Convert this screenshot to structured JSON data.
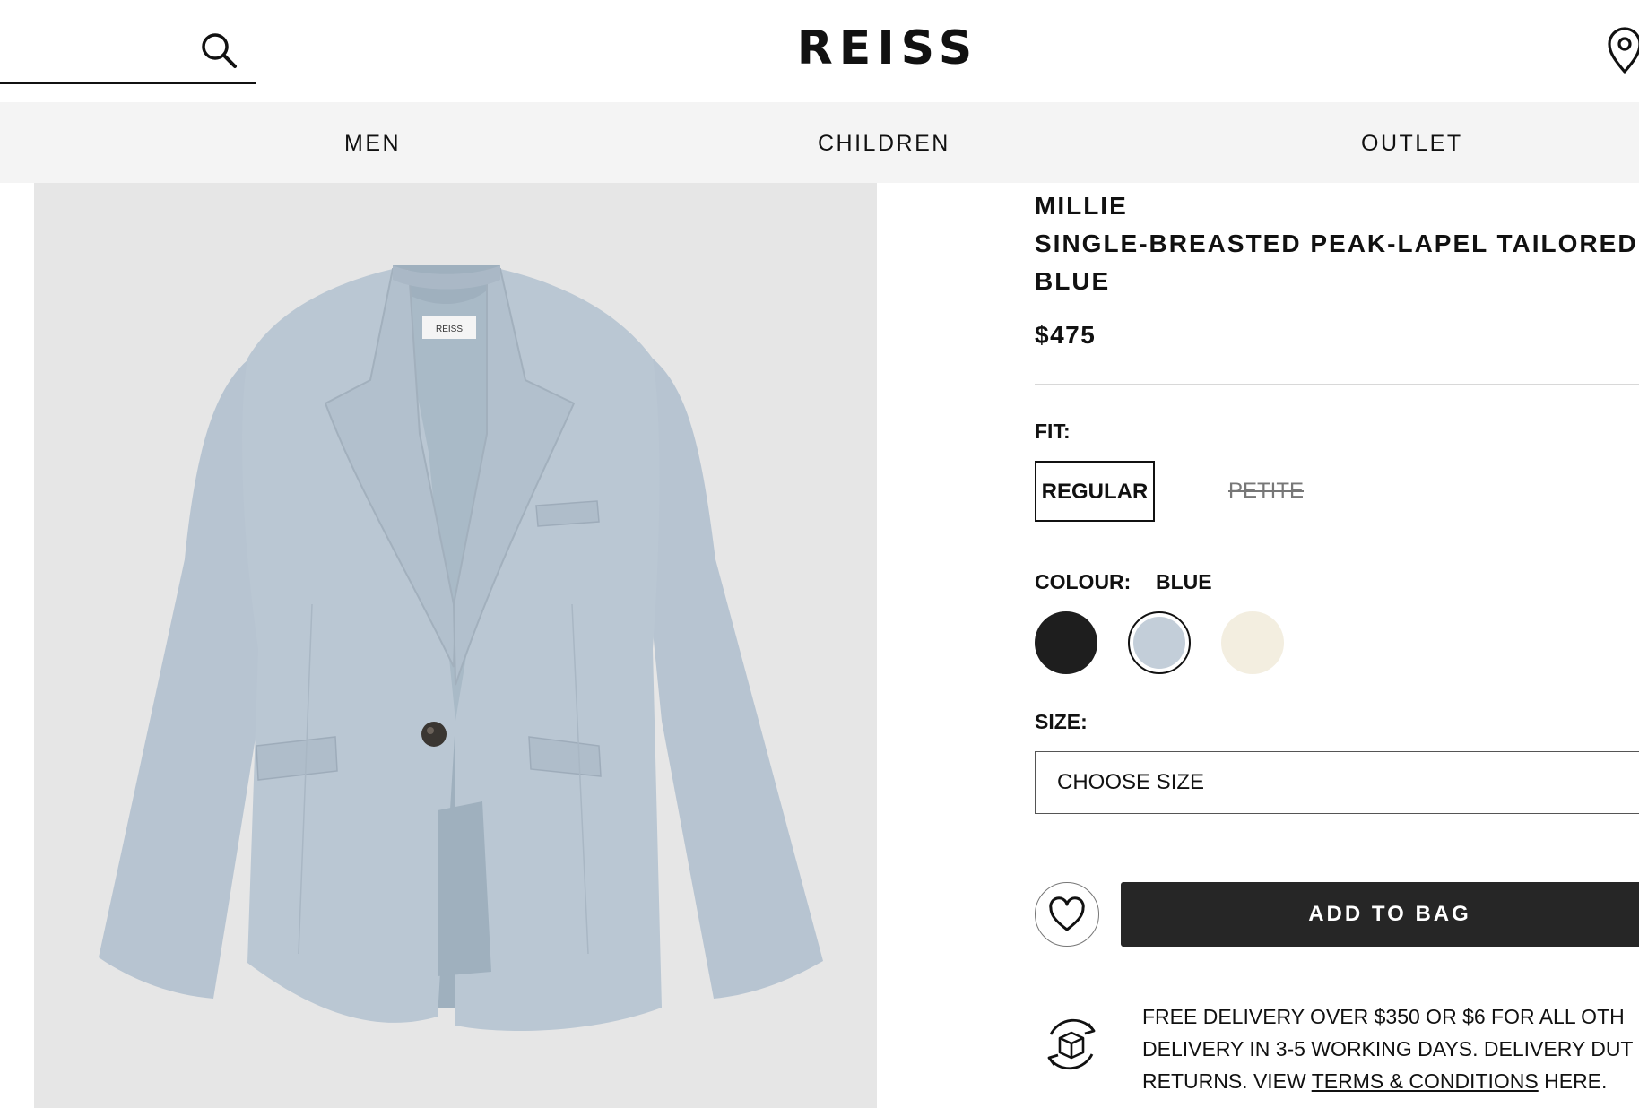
{
  "header": {
    "search_placeholder": "",
    "logo_text": "REISS",
    "icons": [
      "search-icon",
      "store-locator-icon"
    ]
  },
  "nav": {
    "items": [
      {
        "label": "MEN"
      },
      {
        "label": "CHILDREN"
      },
      {
        "label": "OUTLET"
      }
    ]
  },
  "product": {
    "brand": "MILLIE",
    "name": "SINGLE-BREASTED PEAK-LAPEL TAILORED",
    "colour_name": "BLUE",
    "price": "$475",
    "fit": {
      "label": "FIT:",
      "options": [
        {
          "label": "REGULAR",
          "selected": true,
          "available": true
        },
        {
          "label": "PETITE",
          "selected": false,
          "available": false
        }
      ]
    },
    "colour": {
      "label": "COLOUR:",
      "selected": "BLUE",
      "swatches": [
        {
          "name": "black",
          "hex": "#1e1e1e",
          "selected": false
        },
        {
          "name": "blue",
          "hex": "#c3ced9",
          "selected": true
        },
        {
          "name": "cream",
          "hex": "#f3eee0",
          "selected": false
        }
      ]
    },
    "size": {
      "label": "SIZE:",
      "selected_text": "CHOOSE SIZE"
    },
    "add_to_bag_label": "ADD TO BAG",
    "delivery": {
      "line1": "FREE DELIVERY OVER $350 OR $6 FOR ALL OTH",
      "line2": "DELIVERY IN 3-5 WORKING DAYS. DELIVERY DUT",
      "line3_prefix": "RETURNS. VIEW ",
      "terms_link": "TERMS & CONDITIONS",
      "line3_suffix": " HERE."
    },
    "image_label": "REISS"
  },
  "colors": {
    "accent_dark": "#262626",
    "nav_background": "#f4f4f4",
    "image_background": "#e6e6e6",
    "jacket_blue": "#b9c6d3"
  }
}
